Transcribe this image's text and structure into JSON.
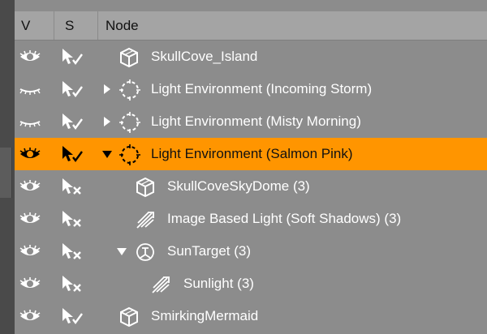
{
  "header": {
    "col_v": "V",
    "col_s": "S",
    "col_node": "Node"
  },
  "colors": {
    "selected_row": "#ff9500",
    "panel": "#8c8c8c",
    "header": "#a4a4a4"
  },
  "rows": [
    {
      "label": "SkullCove_Island",
      "visibility": "visible",
      "select": "selectable",
      "icon": "cube-icon",
      "expander": "none",
      "selected": false
    },
    {
      "label": "Light Environment (Incoming Storm)",
      "visibility": "hidden",
      "select": "selectable",
      "icon": "light-environment-icon",
      "expander": "collapsed",
      "selected": false
    },
    {
      "label": "Light Environment (Misty Morning)",
      "visibility": "hidden",
      "select": "selectable",
      "icon": "light-environment-icon",
      "expander": "collapsed",
      "selected": false
    },
    {
      "label": "Light Environment (Salmon Pink)",
      "visibility": "visible",
      "select": "selectable",
      "icon": "light-environment-icon",
      "expander": "expanded",
      "selected": true
    },
    {
      "label": "SkullCoveSkyDome (3)",
      "visibility": "visible",
      "select": "not-selectable",
      "icon": "cube-icon",
      "expander": "none",
      "selected": false
    },
    {
      "label": "Image Based Light (Soft Shadows) (3)",
      "visibility": "visible",
      "select": "not-selectable",
      "icon": "light-rays-icon",
      "expander": "none",
      "selected": false
    },
    {
      "label": "SunTarget (3)",
      "visibility": "visible",
      "select": "not-selectable",
      "icon": "null-node-icon",
      "expander": "expanded",
      "selected": false
    },
    {
      "label": "Sunlight (3)",
      "visibility": "visible",
      "select": "not-selectable",
      "icon": "light-rays-icon",
      "expander": "none",
      "selected": false
    },
    {
      "label": "SmirkingMermaid",
      "visibility": "visible",
      "select": "selectable",
      "icon": "cube-icon",
      "expander": "none",
      "selected": false
    }
  ]
}
